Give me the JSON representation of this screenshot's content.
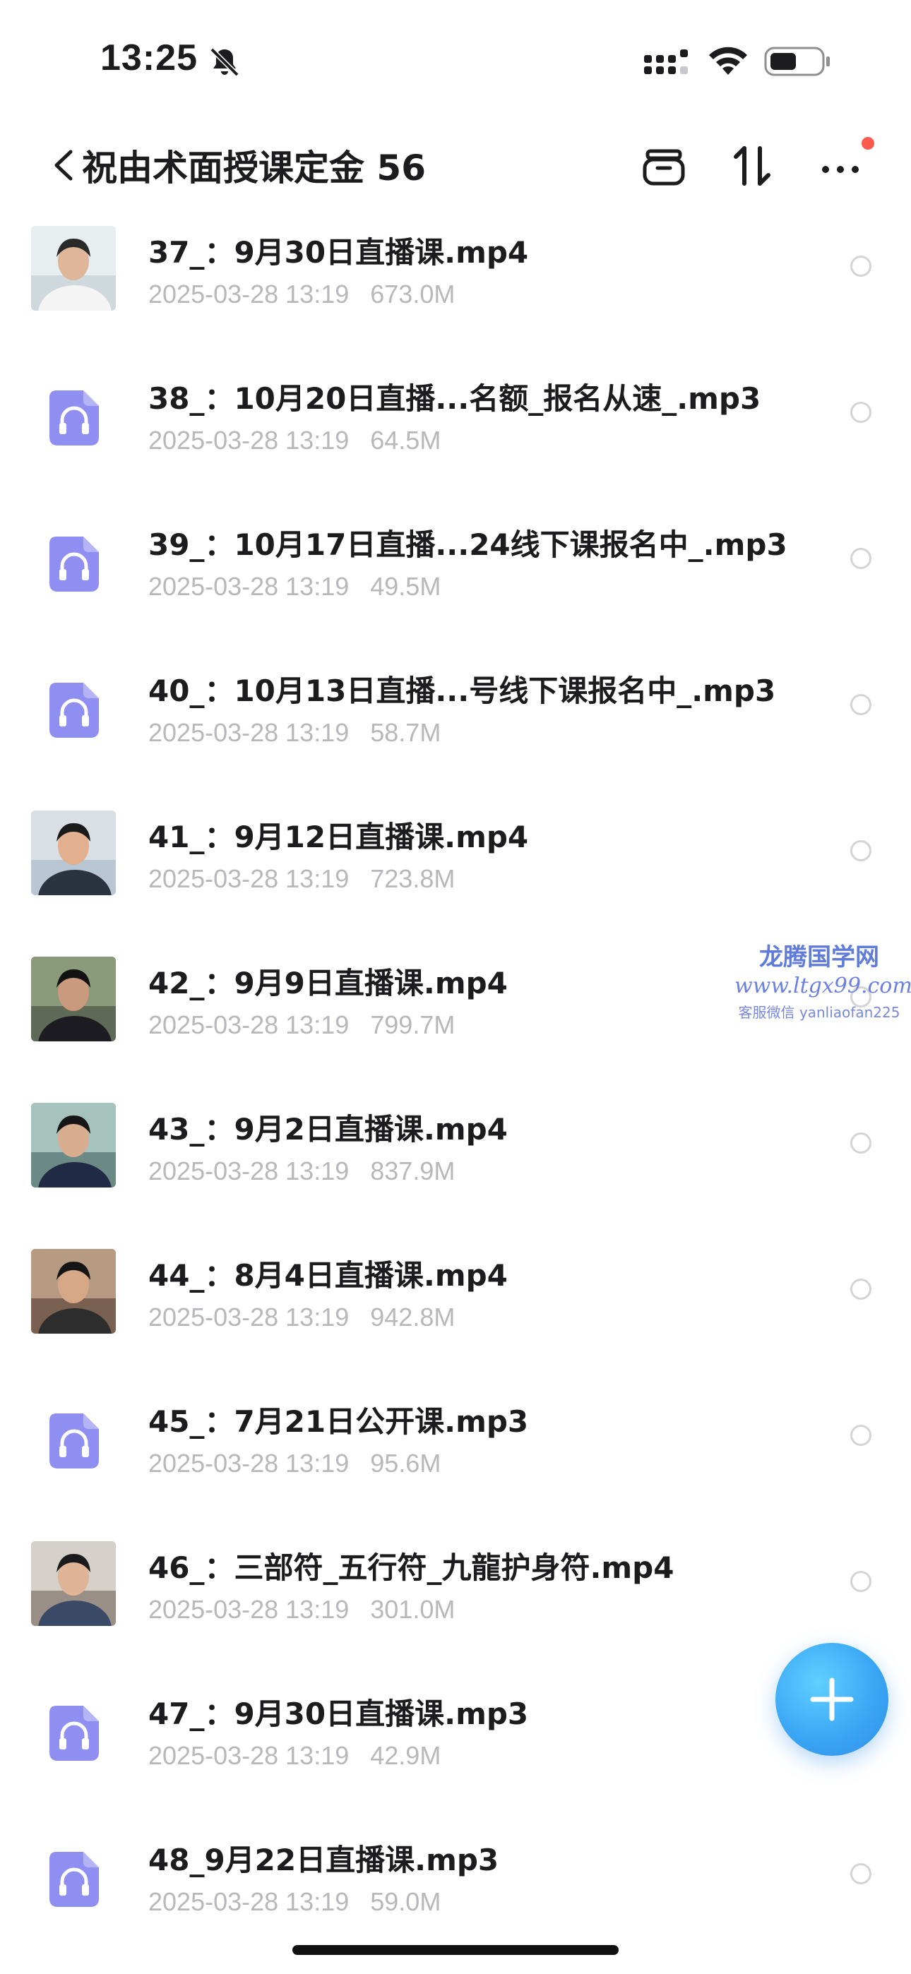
{
  "status_bar": {
    "time": "13:25",
    "icons": [
      "bell-slash-icon",
      "signal-icon",
      "wifi-icon",
      "battery-icon"
    ]
  },
  "header": {
    "title": "祝由术面授课定金 56",
    "icons": [
      "archive-icon",
      "sort-icon",
      "more-icon"
    ],
    "notification_dot_color": "#ff5a4e"
  },
  "files": [
    {
      "name": "37_：9月30日直播课.mp4",
      "date": "2025-03-28 13:19",
      "size": "673.0M",
      "type": "video",
      "thumb": "video-thumb-1"
    },
    {
      "name": "38_：10月20日直播...名额_报名从速_.mp3",
      "date": "2025-03-28 13:19",
      "size": "64.5M",
      "type": "audio"
    },
    {
      "name": "39_：10月17日直播...24线下课报名中_.mp3",
      "date": "2025-03-28 13:19",
      "size": "49.5M",
      "type": "audio"
    },
    {
      "name": "40_：10月13日直播...号线下课报名中_.mp3",
      "date": "2025-03-28 13:19",
      "size": "58.7M",
      "type": "audio"
    },
    {
      "name": "41_：9月12日直播课.mp4",
      "date": "2025-03-28 13:19",
      "size": "723.8M",
      "type": "video",
      "thumb": "video-thumb-2"
    },
    {
      "name": "42_：9月9日直播课.mp4",
      "date": "2025-03-28 13:19",
      "size": "799.7M",
      "type": "video",
      "thumb": "video-thumb-3"
    },
    {
      "name": "43_：9月2日直播课.mp4",
      "date": "2025-03-28 13:19",
      "size": "837.9M",
      "type": "video",
      "thumb": "video-thumb-4"
    },
    {
      "name": "44_：8月4日直播课.mp4",
      "date": "2025-03-28 13:19",
      "size": "942.8M",
      "type": "video",
      "thumb": "video-thumb-5"
    },
    {
      "name": "45_：7月21日公开课.mp3",
      "date": "2025-03-28 13:19",
      "size": "95.6M",
      "type": "audio"
    },
    {
      "name": "46_：三部符_五行符_九龍护身符.mp4",
      "date": "2025-03-28 13:19",
      "size": "301.0M",
      "type": "video",
      "thumb": "video-thumb-6"
    },
    {
      "name": "47_：9月30日直播课.mp3",
      "date": "2025-03-28 13:19",
      "size": "42.9M",
      "type": "audio"
    },
    {
      "name": "48_9月22日直播课.mp3",
      "date": "2025-03-28 13:19",
      "size": "59.0M",
      "type": "audio"
    }
  ],
  "watermark": {
    "title": "龙腾国学网",
    "url": "www.ltgx99.com",
    "contact": "客服微信 yanliaofan225"
  },
  "fab": {
    "icon": "plus-icon",
    "color": "#3ba7f5"
  },
  "colors": {
    "audio_icon": "#8f8ff2",
    "meta_text": "#b8b8bc",
    "radio_border": "#d4d4d8"
  }
}
